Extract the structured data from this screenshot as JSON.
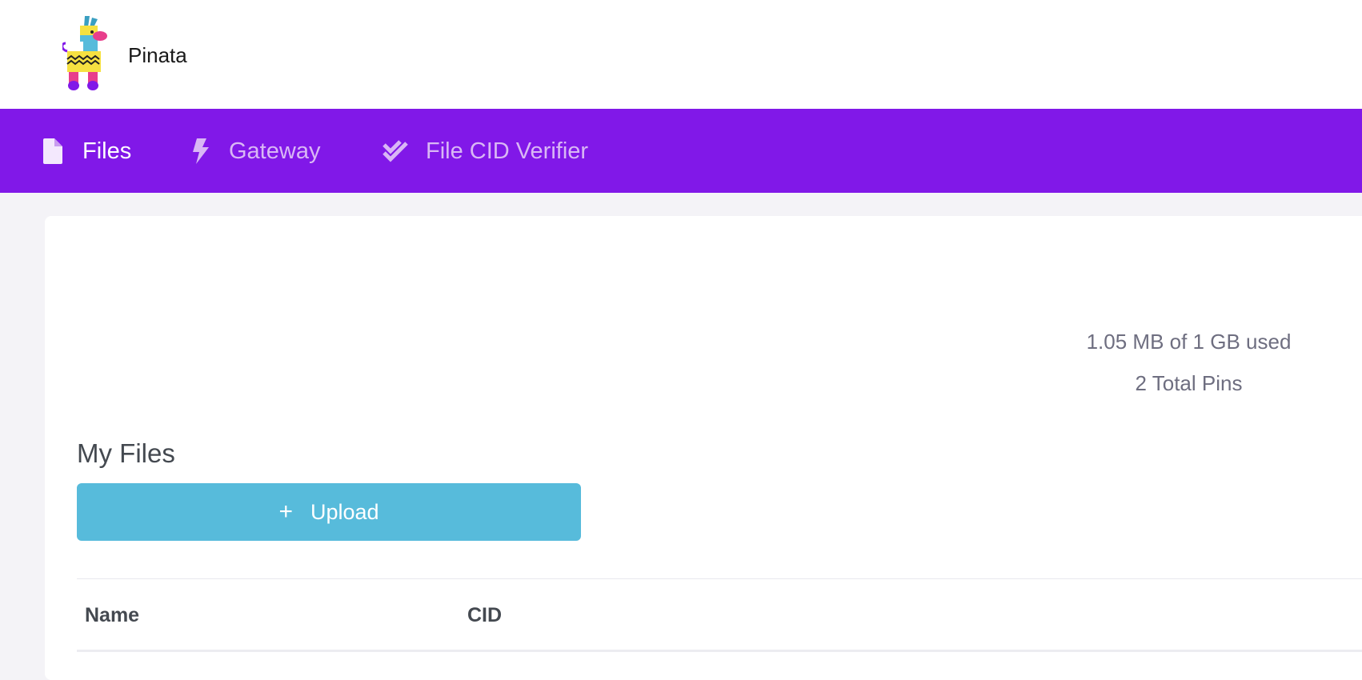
{
  "header": {
    "brand": "Pinata",
    "logo_icon": "pinata-llama-logo"
  },
  "nav": {
    "items": [
      {
        "label": "Files",
        "icon": "file-icon",
        "active": true
      },
      {
        "label": "Gateway",
        "icon": "lightning-icon",
        "active": false
      },
      {
        "label": "File CID Verifier",
        "icon": "double-check-icon",
        "active": false
      }
    ]
  },
  "stats": {
    "usage": "1.05 MB of 1 GB used",
    "pins": "2 Total Pins"
  },
  "files": {
    "title": "My Files",
    "upload_label": "Upload",
    "upload_icon": "plus-icon",
    "columns": [
      "Name",
      "CID"
    ]
  },
  "colors": {
    "nav_bg": "#8118e8",
    "nav_inactive": "#d9b7f5",
    "upload_bg": "#57bbdb",
    "page_bg": "#f4f3f7"
  }
}
